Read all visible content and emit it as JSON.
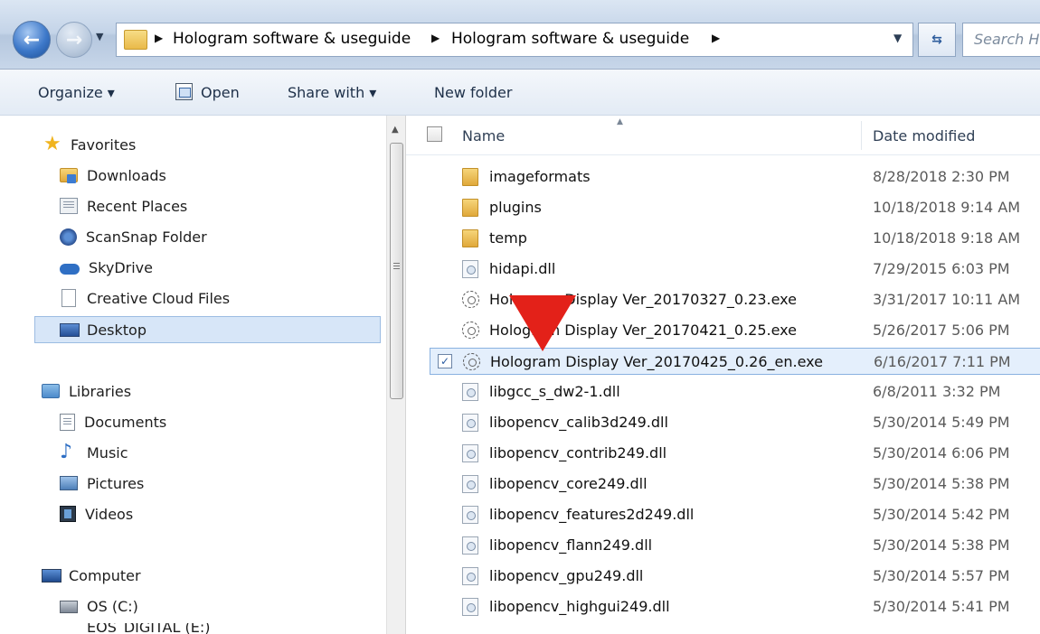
{
  "address_bar": {
    "crumbs": [
      "Hologram software & useguide",
      "Hologram software & useguide"
    ],
    "search_placeholder": "Search H"
  },
  "toolbar": {
    "organize": "Organize ▾",
    "open": "Open",
    "share_with": "Share with ▾",
    "new_folder": "New folder"
  },
  "nav_pane": {
    "favorites": {
      "title": "Favorites",
      "items": [
        "Downloads",
        "Recent Places",
        "ScanSnap Folder",
        "SkyDrive",
        "Creative Cloud Files",
        "Desktop"
      ]
    },
    "libraries": {
      "title": "Libraries",
      "items": [
        "Documents",
        "Music",
        "Pictures",
        "Videos"
      ]
    },
    "computer": {
      "title": "Computer",
      "items": [
        "OS (C:)",
        "EOS_DIGITAL (E:)"
      ]
    }
  },
  "columns": {
    "name": "Name",
    "date_modified": "Date modified"
  },
  "files": [
    {
      "name": "imageformats",
      "date": "8/28/2018 2:30 PM",
      "type": "folder"
    },
    {
      "name": "plugins",
      "date": "10/18/2018 9:14 AM",
      "type": "folder"
    },
    {
      "name": "temp",
      "date": "10/18/2018 9:18 AM",
      "type": "folder"
    },
    {
      "name": "hidapi.dll",
      "date": "7/29/2015 6:03 PM",
      "type": "dll"
    },
    {
      "name": "Hologram Display Ver_20170327_0.23.exe",
      "date": "3/31/2017 10:11 AM",
      "type": "exe"
    },
    {
      "name": "Hologram Display Ver_20170421_0.25.exe",
      "date": "5/26/2017 5:06 PM",
      "type": "exe"
    },
    {
      "name": "Hologram Display Ver_20170425_0.26_en.exe",
      "date": "6/16/2017 7:11 PM",
      "type": "exe",
      "selected": true
    },
    {
      "name": "libgcc_s_dw2-1.dll",
      "date": "6/8/2011 3:32 PM",
      "type": "dll"
    },
    {
      "name": "libopencv_calib3d249.dll",
      "date": "5/30/2014 5:49 PM",
      "type": "dll"
    },
    {
      "name": "libopencv_contrib249.dll",
      "date": "5/30/2014 6:06 PM",
      "type": "dll"
    },
    {
      "name": "libopencv_core249.dll",
      "date": "5/30/2014 5:38 PM",
      "type": "dll"
    },
    {
      "name": "libopencv_features2d249.dll",
      "date": "5/30/2014 5:42 PM",
      "type": "dll"
    },
    {
      "name": "libopencv_flann249.dll",
      "date": "5/30/2014 5:38 PM",
      "type": "dll"
    },
    {
      "name": "libopencv_gpu249.dll",
      "date": "5/30/2014 5:57 PM",
      "type": "dll"
    },
    {
      "name": "libopencv_highgui249.dll",
      "date": "5/30/2014 5:41 PM",
      "type": "dll"
    }
  ],
  "colors": {
    "selection_fill": "#e4effc",
    "selection_border": "#89b1e0",
    "annotation_arrow": "#e32119"
  }
}
